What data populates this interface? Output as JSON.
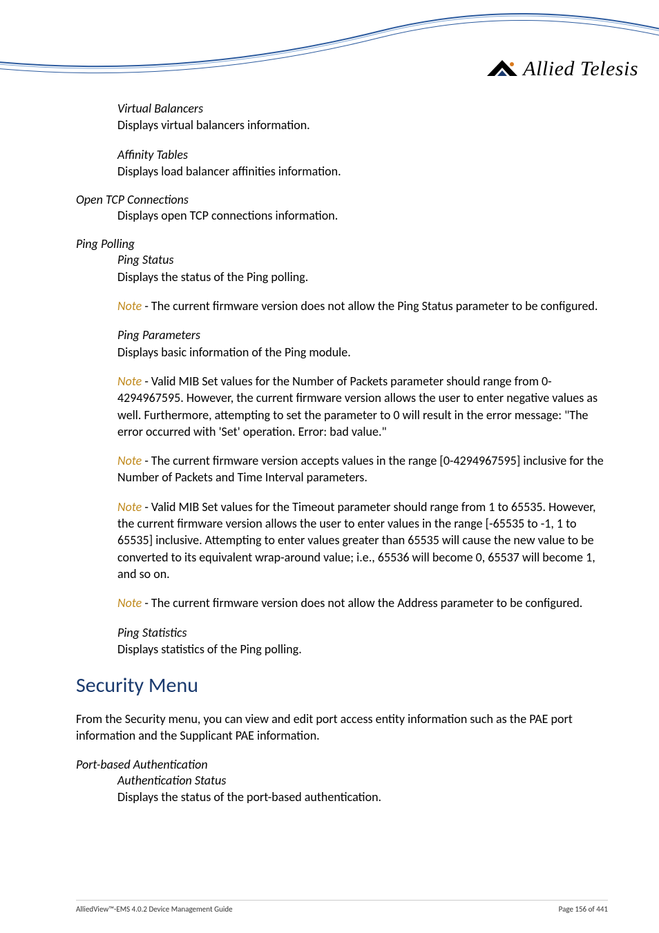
{
  "brand": {
    "name": "Allied Telesis"
  },
  "sections": {
    "virtualBalancers": {
      "title": "Virtual Balancers",
      "desc": "Displays virtual balancers information."
    },
    "affinityTables": {
      "title": "Affinity Tables",
      "desc": "Displays load balancer affinities information."
    },
    "openTcp": {
      "title": "Open TCP Connections",
      "desc": "Displays open TCP connections information."
    },
    "pingPolling": {
      "title": "Ping Polling",
      "pingStatus": {
        "title": "Ping Status",
        "desc": "Displays the status of the Ping polling."
      },
      "note1": " - The current firmware version does not allow the Ping Status parameter to be configured.",
      "pingParameters": {
        "title": "Ping Parameters",
        "desc": "Displays basic information of the Ping module."
      },
      "note2": " - Valid MIB Set values for the Number of Packets parameter should range from 0-4294967595. However, the current firmware version allows the user to enter negative values as well. Furthermore, attempting to set the parameter to 0 will result in the error message: \"The error occurred with 'Set' operation. Error: bad value.\"",
      "note3": " - The current firmware version accepts values in the range [0-4294967595] inclusive for the Number of Packets and Time Interval parameters.",
      "note4": " - Valid MIB Set values for the Timeout parameter should range from 1 to 65535. However, the current firmware version allows the user to enter values in the range [-65535 to -1, 1 to 65535] inclusive. Attempting to enter values greater than 65535 will cause the new value to be converted to its equivalent wrap-around value; i.e., 65536 will become 0, 65537 will become 1, and so on.",
      "note5": " - The current firmware version does not allow the Address parameter to be configured.",
      "pingStatistics": {
        "title": "Ping Statistics",
        "desc": "Displays statistics of the Ping polling."
      }
    },
    "securityMenu": {
      "heading": "Security Menu",
      "intro": "From the Security menu, you can view and edit port access entity information such as the PAE port information and the Supplicant PAE information.",
      "portAuth": {
        "title": "Port-based Authentication",
        "authStatus": {
          "title": "Authentication Status",
          "desc": "Displays the status of the port-based authentication."
        }
      }
    }
  },
  "noteLabel": "Note",
  "footer": {
    "left": "AlliedView™-EMS 4.0.2 Device Management Guide",
    "right": "Page 156 of 441"
  }
}
